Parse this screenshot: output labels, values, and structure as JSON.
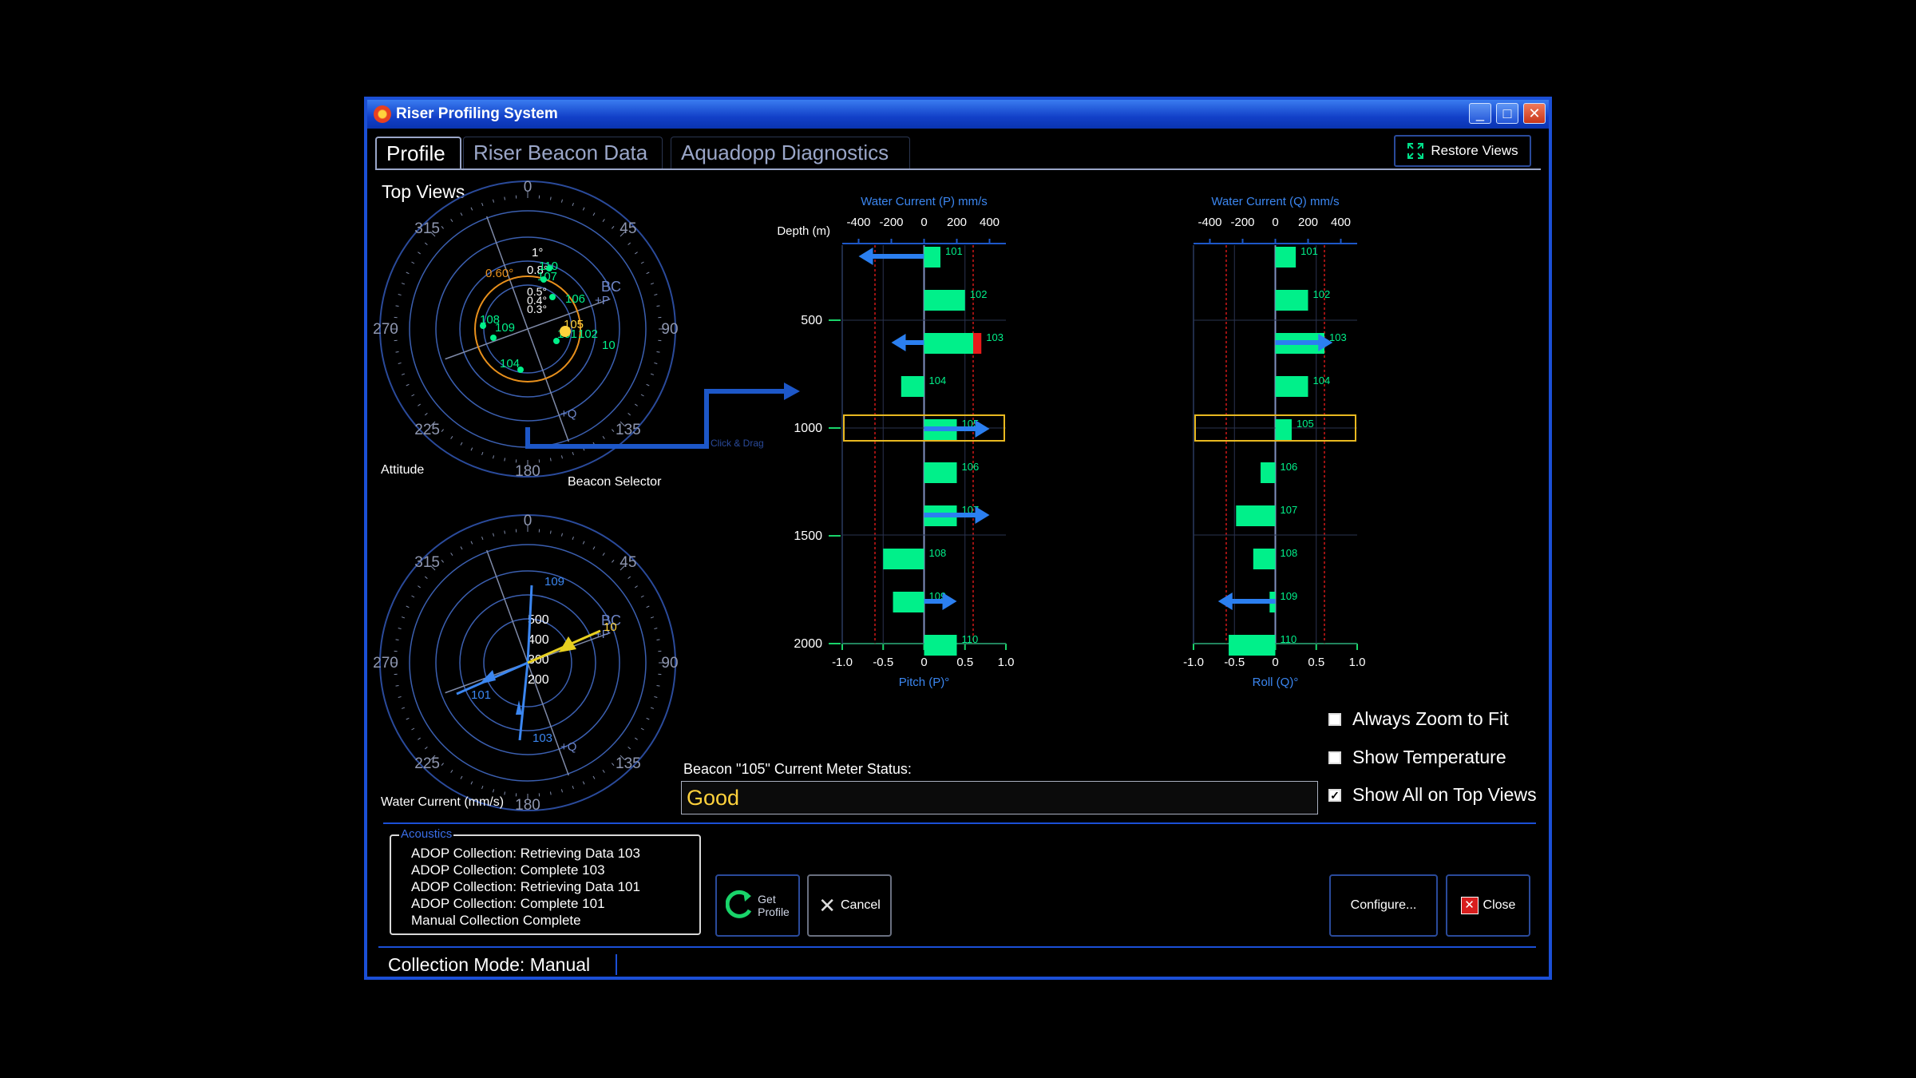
{
  "window": {
    "title": "Riser Profiling System",
    "controls": {
      "minimize": "_",
      "maximize": "□",
      "close": "✕"
    }
  },
  "tabs": [
    {
      "label": "Profile",
      "active": true
    },
    {
      "label": "Riser Beacon Data",
      "active": false
    },
    {
      "label": "Aquadopp Diagnostics",
      "active": false
    }
  ],
  "toolbar": {
    "restore_views": "Restore Views",
    "restore_icon": "expand-arrows-icon"
  },
  "top_views": {
    "heading": "Top Views",
    "attitude": {
      "label": "Attitude",
      "compass": [
        "0",
        "45",
        "90",
        "135",
        "180",
        "225",
        "270",
        "315"
      ],
      "rings": [
        "1°",
        "0.8°",
        "0.5°",
        "0.4°",
        "0.3°"
      ],
      "limit_label": "0.60°",
      "axis_labels": [
        "BC",
        "+P",
        "+Q"
      ],
      "beacons": [
        "101",
        "102",
        "104",
        "105",
        "106",
        "107",
        "108",
        "109",
        "110",
        "10"
      ]
    },
    "water_current": {
      "label": "Water Current (mm/s)",
      "compass": [
        "0",
        "45",
        "90",
        "135",
        "180",
        "225",
        "270",
        "315"
      ],
      "rings": [
        "500",
        "400",
        "300",
        "200"
      ],
      "axis_labels": [
        "BC",
        "+P",
        "+Q"
      ],
      "beacons": [
        "109",
        "101",
        "103",
        "10"
      ]
    },
    "beacon_selector": "Beacon Selector",
    "click_drag": "Click & Drag"
  },
  "chart_data": [
    {
      "type": "bar",
      "title": "Water Current (P) mm/s",
      "ylabel": "Depth (m)",
      "xlabel": "Pitch (P)°",
      "top_axis_ticks": [
        "-400",
        "-200",
        "0",
        "200",
        "400"
      ],
      "bottom_axis_ticks": [
        "-1.0",
        "-0.5",
        "0",
        "0.5",
        "1.0"
      ],
      "depth_ticks": [
        "500",
        "1000",
        "1500",
        "2000"
      ],
      "categories": [
        "101",
        "102",
        "103",
        "104",
        "105",
        "106",
        "107",
        "108",
        "109",
        "110"
      ],
      "values": [
        0.2,
        0.5,
        0.6,
        -0.28,
        0.4,
        0.4,
        0.4,
        -0.5,
        -0.38,
        0.4
      ],
      "limit_exceed": {
        "103": 0.1
      },
      "current_arrows_mm_s": {
        "101": -400,
        "103": -200,
        "105": 400,
        "107": 400,
        "109": 200
      },
      "limits": [
        -0.6,
        0.6
      ],
      "selected": "105",
      "xlim": [
        -1.0,
        1.0
      ]
    },
    {
      "type": "bar",
      "title": "Water Current (Q) mm/s",
      "xlabel": "Roll (Q)°",
      "top_axis_ticks": [
        "-400",
        "-200",
        "0",
        "200",
        "400"
      ],
      "bottom_axis_ticks": [
        "-1.0",
        "-0.5",
        "0",
        "0.5",
        "1.0"
      ],
      "categories": [
        "101",
        "102",
        "103",
        "104",
        "105",
        "106",
        "107",
        "108",
        "109",
        "110"
      ],
      "values": [
        0.25,
        0.4,
        0.6,
        0.4,
        0.2,
        -0.18,
        -0.48,
        -0.27,
        -0.07,
        -0.57
      ],
      "current_arrows_mm_s": {
        "103": 350,
        "109": -350
      },
      "limits": [
        -0.6,
        0.6
      ],
      "selected": "105",
      "xlim": [
        -1.0,
        1.0
      ]
    }
  ],
  "meter_status": {
    "label": "Beacon \"105\" Current Meter Status:",
    "value": "Good"
  },
  "options": [
    {
      "label": "Always Zoom to Fit",
      "checked": false
    },
    {
      "label": "Show Temperature",
      "checked": false
    },
    {
      "label": "Show All on Top Views",
      "checked": true
    }
  ],
  "acoustics": {
    "title": "Acoustics",
    "log": [
      "ADOP Collection: Retrieving Data 103",
      "ADOP Collection: Complete 103",
      "ADOP Collection: Retrieving Data 101",
      "ADOP Collection: Complete 101",
      "Manual Collection Complete"
    ]
  },
  "buttons": {
    "get_profile_line1": "Get",
    "get_profile_line2": "Profile",
    "cancel": "Cancel",
    "configure": "Configure...",
    "close": "Close"
  },
  "status": {
    "collection_mode": "Collection Mode: Manual"
  },
  "colors": {
    "accent": "#1b4fd6",
    "bar": "#00f08a",
    "arrow": "#2b7ff0",
    "warn": "#e81a1a",
    "selected": "#e8b820",
    "good": "#ffd23c"
  }
}
